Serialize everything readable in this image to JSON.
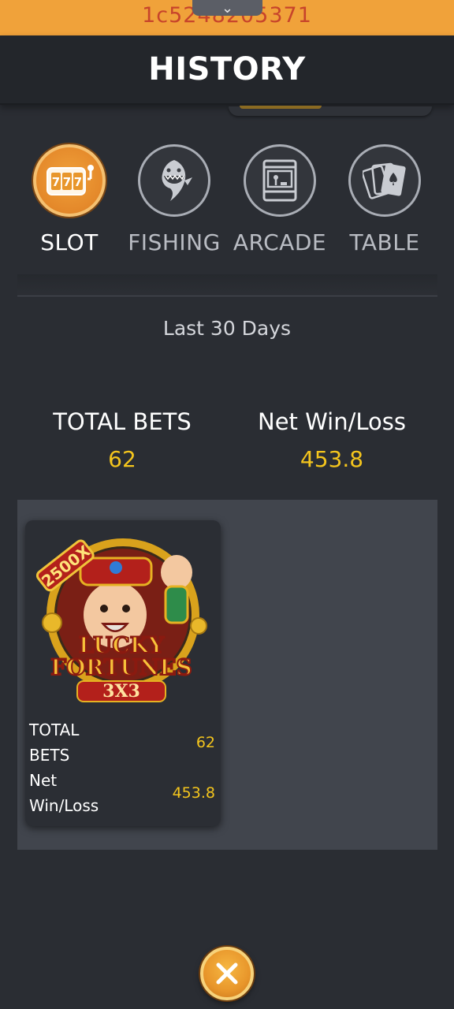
{
  "topbar": {
    "id_text": "1c5248205371",
    "pull_tab_glyph": "⌄"
  },
  "header": {
    "title": "HISTORY"
  },
  "tabs": [
    {
      "label": "SLOT",
      "icon": "slot-machine-icon",
      "active": true
    },
    {
      "label": "FISHING",
      "icon": "shark-icon",
      "active": false
    },
    {
      "label": "ARCADE",
      "icon": "arcade-cabinet-icon",
      "active": false
    },
    {
      "label": "TABLE",
      "icon": "playing-cards-icon",
      "active": false
    }
  ],
  "period": "Last 30 Days",
  "summary": {
    "total_bets_label": "TOTAL BETS",
    "total_bets_value": "62",
    "net_label": "Net Win/Loss",
    "net_value": "453.8"
  },
  "games": [
    {
      "art_text": {
        "multiplier": "2500X",
        "line1": "LUCKY",
        "line2": "FORTUNES",
        "line3": "3X3"
      },
      "total_bets_label": "TOTAL BETS",
      "total_bets_value": "62",
      "net_label": "Net Win/Loss",
      "net_value": "453.8"
    }
  ],
  "colors": {
    "accent": "#f0a23a",
    "value": "#f4c51d",
    "background": "#2a2d33",
    "panel": "#41454d"
  },
  "close_icon": "close-icon"
}
